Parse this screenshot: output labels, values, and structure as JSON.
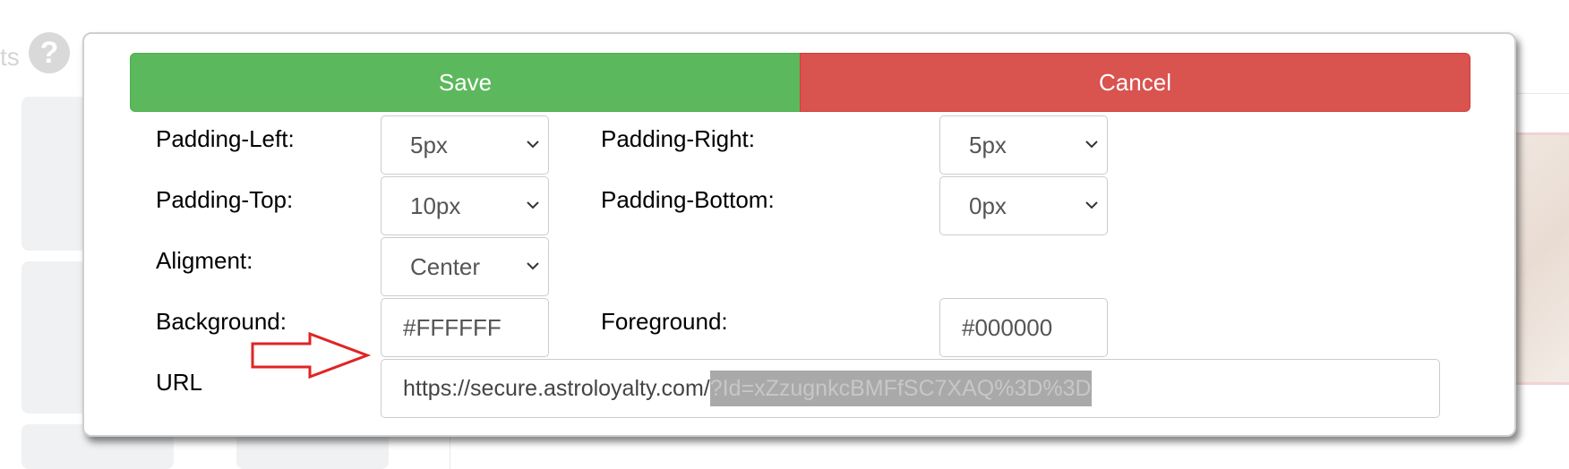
{
  "background": {
    "help_text": "ts"
  },
  "modal": {
    "save_label": "Save",
    "cancel_label": "Cancel",
    "colors": {
      "save": "#5cb85c",
      "cancel": "#d9534f"
    },
    "fields": {
      "padding_left": {
        "label": "Padding-Left:",
        "value": "5px"
      },
      "padding_right": {
        "label": "Padding-Right:",
        "value": "5px"
      },
      "padding_top": {
        "label": "Padding-Top:",
        "value": "10px"
      },
      "padding_bottom": {
        "label": "Padding-Bottom:",
        "value": "0px"
      },
      "alignment": {
        "label": "Aligment:",
        "value": "Center"
      },
      "background": {
        "label": "Background:",
        "value": "#FFFFFF"
      },
      "foreground": {
        "label": "Foreground:",
        "value": "#000000"
      },
      "url": {
        "label": "URL",
        "value_visible": "https://secure.astroloyalty.com/",
        "value_redacted": "?Id=xZzugnkcBMFfSC7XAQ%3D%3D"
      }
    },
    "annotation_icon": "right-arrow-outline-icon"
  }
}
